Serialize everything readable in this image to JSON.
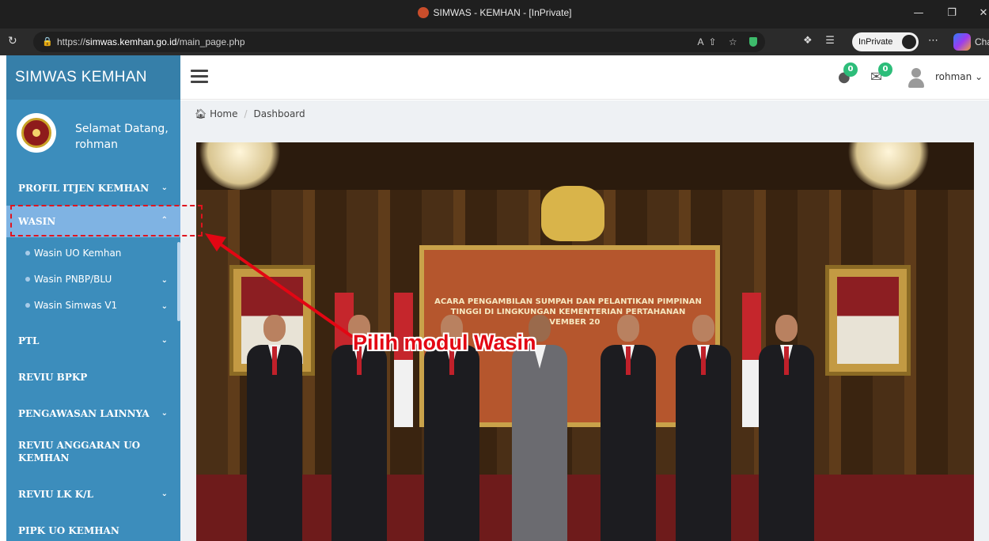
{
  "browser": {
    "title": "SIMWAS - KEMHAN - [InPrivate]",
    "url_scheme": "https://",
    "url_host": "simwas.kemhan.go.id",
    "url_path": "/main_page.php",
    "inprivate_label": "InPrivate",
    "partial_tab": "Cha"
  },
  "sidebar": {
    "brand": "SIMWAS KEMHAN",
    "welcome_line1": "Selamat Datang,",
    "welcome_line2": "rohman",
    "items": [
      {
        "label": "PROFIL ITJEN KEMHAN",
        "has_chevron": true
      },
      {
        "label": "WASIN",
        "active": true
      },
      {
        "label": "PTL",
        "has_chevron": true
      },
      {
        "label": "REVIU BPKP"
      },
      {
        "label": "PENGAWASAN LAINNYA",
        "has_chevron": true
      },
      {
        "label_line1": "REVIU ANGGARAN UO",
        "label_line2": "KEMHAN"
      },
      {
        "label": "REVIU LK K/L",
        "has_chevron": true
      },
      {
        "label": "PIPK UO KEMHAN"
      }
    ],
    "wasin_sub": [
      {
        "label": "Wasin UO Kemhan"
      },
      {
        "label": "Wasin PNBP/BLU",
        "has_chevron": true
      },
      {
        "label": "Wasin Simwas V1",
        "has_chevron": true
      }
    ]
  },
  "header": {
    "chat_badge": "0",
    "mail_badge": "0",
    "username": "rohman"
  },
  "breadcrumb": {
    "home": "Home",
    "current": "Dashboard"
  },
  "banner": {
    "backdrop_text": "ACARA PENGAMBILAN SUMPAH DAN PELANTIKAN PIMPINAN TINGGI DI LINGKUNGAN KEMENTERIAN PERTAHANAN",
    "backdrop_date": "NOVEMBER 20"
  },
  "annotation": {
    "text": "Pilih modul Wasin",
    "color": "#e30613"
  },
  "colors": {
    "sidebar": "#3c8dbc",
    "sidebar_active": "#7fb3e3",
    "badge": "#2dbd7a"
  }
}
